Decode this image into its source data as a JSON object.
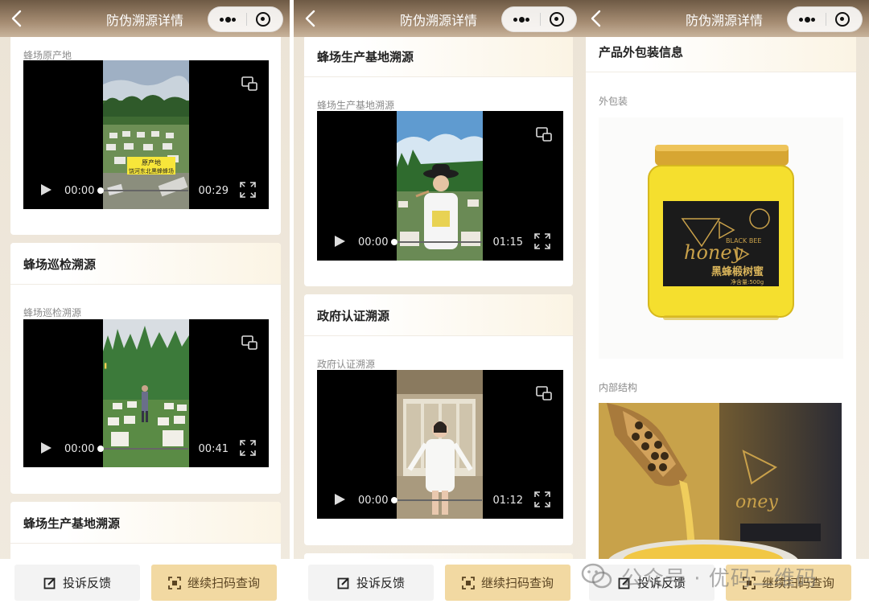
{
  "nav": {
    "title": "防伪溯源详情",
    "back_icon": "chevron-left-icon",
    "more_icon": "more-dots-icon",
    "close_icon": "target-circle-icon"
  },
  "panels": [
    {
      "cards": [
        {
          "title": "",
          "label": "蜂场原产地",
          "video": {
            "current": "00:00",
            "duration": "00:29",
            "caption": "原产地\n饶河东北黑蜂蜂场"
          }
        },
        {
          "title": "蜂场巡检溯源",
          "label": "蜂场巡检溯源",
          "video": {
            "current": "00:00",
            "duration": "00:41"
          }
        },
        {
          "title": "蜂场生产基地溯源"
        }
      ]
    },
    {
      "cards": [
        {
          "title": "蜂场生产基地溯源",
          "label": "蜂场生产基地溯源",
          "video": {
            "current": "00:00",
            "duration": "01:15"
          }
        },
        {
          "title": "政府认证溯源",
          "label": "政府认证溯源",
          "video": {
            "current": "00:00",
            "duration": "01:12"
          }
        }
      ]
    },
    {
      "cards": [
        {
          "title": "产品外包装信息",
          "label_outer": "外包装",
          "label_inner": "内部结构",
          "product": {
            "brand": "BLACK BEE",
            "script": "honey",
            "name": "黑蜂椴树蜜",
            "net": "净含量:500g"
          }
        }
      ]
    }
  ],
  "buttons": {
    "complaint": "投诉反馈",
    "scan": "继续扫码查询"
  },
  "watermark": {
    "text": "公众号 · 优码二维码"
  },
  "colors": {
    "topbar": "#8a735c",
    "scan_button": "#f2d9a2",
    "page_bg": "#efe8dc"
  }
}
